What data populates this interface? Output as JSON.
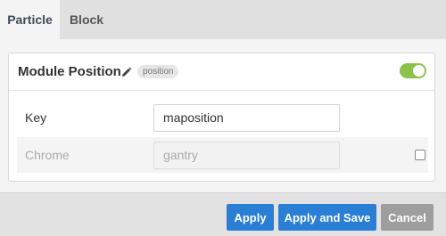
{
  "tabs": [
    {
      "label": "Particle",
      "active": true
    },
    {
      "label": "Block",
      "active": false
    }
  ],
  "module": {
    "title": "Module Position",
    "badge": "position",
    "enabled": true,
    "edit_icon": "pencil-icon"
  },
  "fields": {
    "key": {
      "label": "Key",
      "value": "maposition"
    },
    "chrome": {
      "label": "Chrome",
      "value": "gantry",
      "disabled": true,
      "override_checked": false
    }
  },
  "buttons": {
    "apply": "Apply",
    "apply_save": "Apply and Save",
    "cancel": "Cancel"
  },
  "colors": {
    "primary_button": "#2a7fd4",
    "cancel_button": "#9e9e9e",
    "toggle_on": "#8bc34a"
  }
}
